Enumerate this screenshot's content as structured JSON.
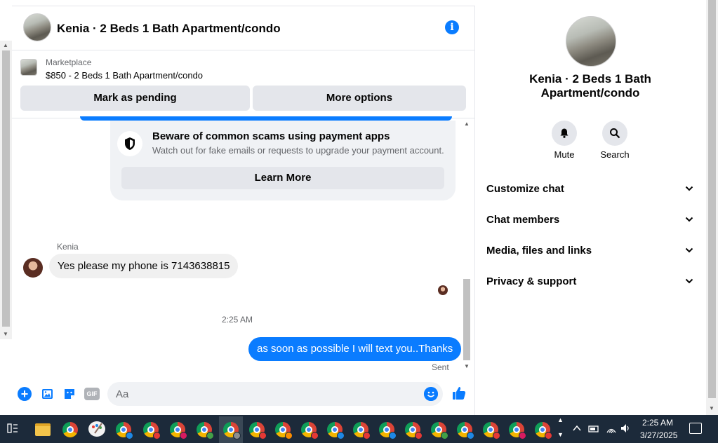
{
  "chat": {
    "title": "Kenia · 2 Beds 1 Bath Apartment/condo",
    "info_icon": "i"
  },
  "marketplace": {
    "label": "Marketplace",
    "listing": "$850 - 2 Beds 1 Bath Apartment/condo",
    "pending_button": "Mark as pending",
    "more_button": "More options"
  },
  "scam_notice": {
    "title": "Beware of common scams using payment apps",
    "description": "Watch out for fake emails or requests to upgrade your payment account.",
    "button": "Learn More"
  },
  "messages": {
    "sender_name": "Kenia",
    "incoming_text": "Yes please my phone is 7143638815",
    "timestamp": "2:25 AM",
    "outgoing_text": "as soon as possible I will text you..Thanks",
    "status": "Sent"
  },
  "composer": {
    "placeholder": "Aa",
    "gif_label": "GIF",
    "icons": [
      "plus-icon",
      "photo-icon",
      "sticker-icon",
      "gif-icon",
      "emoji-icon",
      "thumbs-up-icon"
    ]
  },
  "side_panel": {
    "title": "Kenia · 2 Beds 1 Bath Apartment/condo",
    "mute_label": "Mute",
    "search_label": "Search",
    "sections": [
      {
        "label": "Customize chat"
      },
      {
        "label": "Chat members"
      },
      {
        "label": "Media, files and links"
      },
      {
        "label": "Privacy & support"
      }
    ]
  },
  "taskbar": {
    "time": "2:25 AM",
    "date": "3/27/2025"
  },
  "colors": {
    "accent": "#0a7cff",
    "bubble_gray": "#f0f0f0",
    "button_gray": "#e4e6eb",
    "taskbar": "#1c2a3a"
  }
}
